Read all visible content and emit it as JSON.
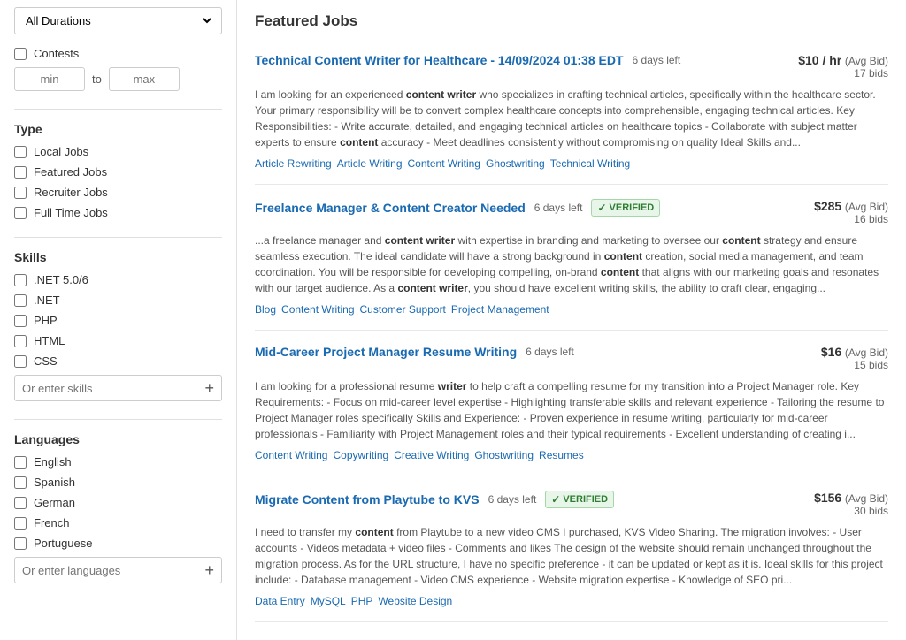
{
  "sidebar": {
    "duration_label": "All Durations",
    "contests_label": "Contests",
    "min_placeholder": "min",
    "max_placeholder": "max",
    "to_label": "to",
    "type_section_title": "Type",
    "type_items": [
      {
        "label": "Local Jobs",
        "checked": false
      },
      {
        "label": "Featured Jobs",
        "checked": false
      },
      {
        "label": "Recruiter Jobs",
        "checked": false
      },
      {
        "label": "Full Time Jobs",
        "checked": false
      }
    ],
    "skills_section_title": "Skills",
    "skills_items": [
      {
        "label": ".NET 5.0/6",
        "checked": false
      },
      {
        "label": ".NET",
        "checked": false
      },
      {
        "label": "PHP",
        "checked": false
      },
      {
        "label": "HTML",
        "checked": false
      },
      {
        "label": "CSS",
        "checked": false
      }
    ],
    "skills_placeholder": "Or enter skills",
    "languages_section_title": "Languages",
    "languages_items": [
      {
        "label": "English",
        "checked": false
      },
      {
        "label": "Spanish",
        "checked": false
      },
      {
        "label": "German",
        "checked": false
      },
      {
        "label": "French",
        "checked": false
      },
      {
        "label": "Portuguese",
        "checked": false
      }
    ],
    "languages_placeholder": "Or enter languages"
  },
  "main": {
    "featured_jobs_title": "Featured Jobs",
    "jobs": [
      {
        "id": 1,
        "title": "Technical Content Writer for Healthcare - 14/09/2024 01:38 EDT",
        "days_left": "6 days left",
        "verified": false,
        "price": "$10 / hr",
        "price_label": "(Avg Bid)",
        "bids": "17 bids",
        "description": "I am looking for an experienced content writer who specializes in crafting technical articles, specifically within the healthcare sector. Your primary responsibility will be to convert complex healthcare concepts into comprehensible, engaging technical articles. Key Responsibilities: - Write accurate, detailed, and engaging technical articles on healthcare topics - Collaborate with subject matter experts to ensure content accuracy - Meet deadlines consistently without compromising on quality Ideal Skills and...",
        "tags": [
          "Article Rewriting",
          "Article Writing",
          "Content Writing",
          "Ghostwriting",
          "Technical Writing"
        ]
      },
      {
        "id": 2,
        "title": "Freelance Manager & Content Creator Needed",
        "days_left": "6 days left",
        "verified": true,
        "price": "$285",
        "price_label": "(Avg Bid)",
        "bids": "16 bids",
        "description": "...a freelance manager and content writer with expertise in branding and marketing to oversee our content strategy and ensure seamless execution. The ideal candidate will have a strong background in content creation, social media management, and team coordination. You will be responsible for developing compelling, on-brand content that aligns with our marketing goals and resonates with our target audience. As a content writer, you should have excellent writing skills, the ability to craft clear, engaging...",
        "tags": [
          "Blog",
          "Content Writing",
          "Customer Support",
          "Project Management"
        ]
      },
      {
        "id": 3,
        "title": "Mid-Career Project Manager Resume Writing",
        "days_left": "6 days left",
        "verified": false,
        "price": "$16",
        "price_label": "(Avg Bid)",
        "bids": "15 bids",
        "description": "I am looking for a professional resume writer to help craft a compelling resume for my transition into a Project Manager role. Key Requirements: - Focus on mid-career level expertise - Highlighting transferable skills and relevant experience - Tailoring the resume to Project Manager roles specifically Skills and Experience: - Proven experience in resume writing, particularly for mid-career professionals - Familiarity with Project Management roles and their typical requirements - Excellent understanding of creating i...",
        "tags": [
          "Content Writing",
          "Copywriting",
          "Creative Writing",
          "Ghostwriting",
          "Resumes"
        ]
      },
      {
        "id": 4,
        "title": "Migrate Content from Playtube to KVS",
        "days_left": "6 days left",
        "verified": true,
        "price": "$156",
        "price_label": "(Avg Bid)",
        "bids": "30 bids",
        "description": "I need to transfer my content from Playtube to a new video CMS I purchased, KVS Video Sharing. The migration involves: - User accounts - Videos metadata + video files - Comments and likes The design of the website should remain unchanged throughout the migration process. As for the URL structure, I have no specific preference - it can be updated or kept as it is. Ideal skills for this project include: - Database management - Video CMS experience - Website migration expertise - Knowledge of SEO pri...",
        "tags": [
          "Data Entry",
          "MySQL",
          "PHP",
          "Website Design"
        ]
      }
    ]
  }
}
